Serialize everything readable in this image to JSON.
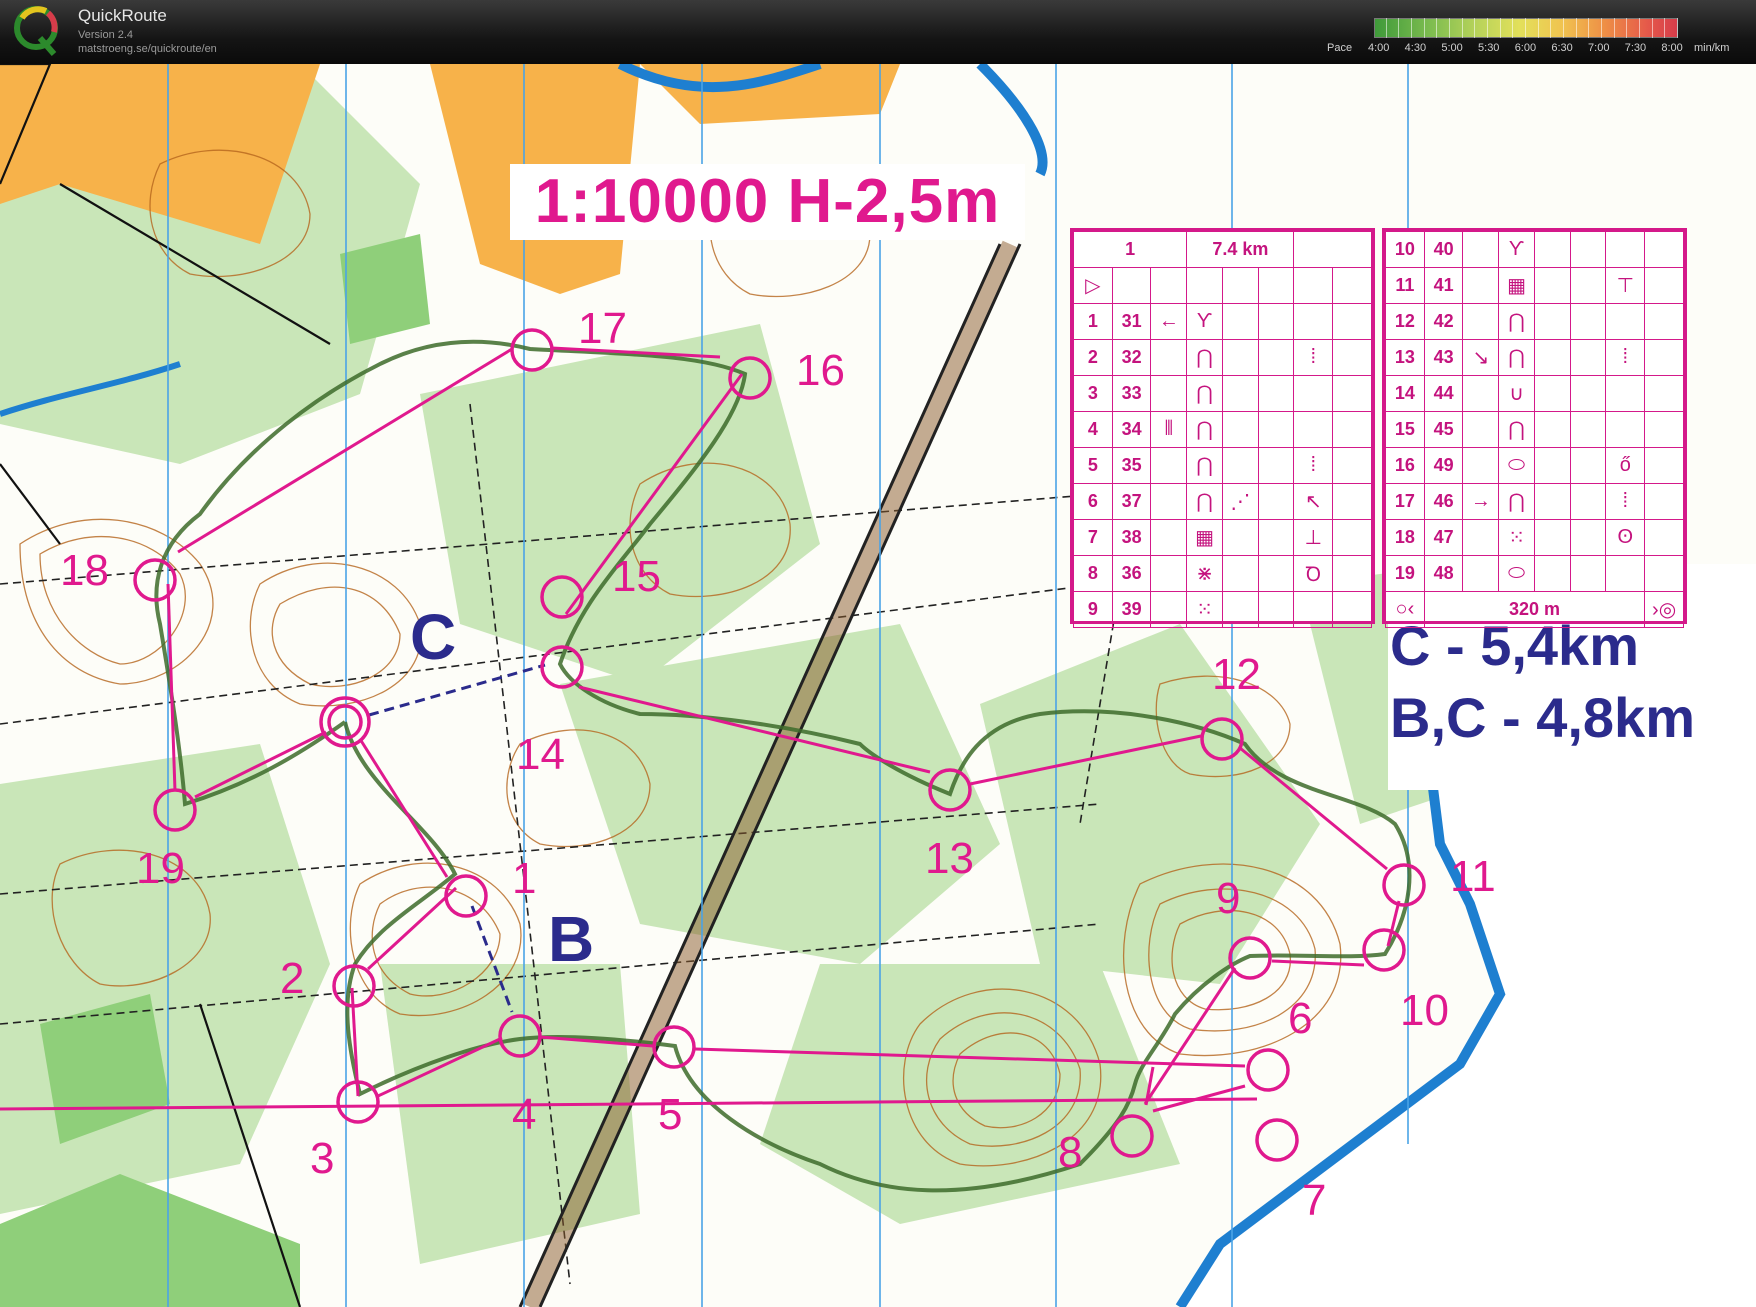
{
  "app": {
    "name": "QuickRoute",
    "version": "Version 2.4",
    "url": "matstroeng.se/quickroute/en",
    "logo_letter": "Q"
  },
  "pace_scale": {
    "label": "Pace",
    "values": [
      "4:00",
      "4:30",
      "5:00",
      "5:30",
      "6:00",
      "6:30",
      "7:00",
      "7:30",
      "8:00"
    ],
    "unit": "min/km"
  },
  "map": {
    "scale_text": "1:10000  H-2,5m",
    "distances": [
      "C - 5,4km",
      "B,C - 4,8km"
    ],
    "course_letters": [
      "C",
      "B"
    ],
    "colors": {
      "course": "#e0198e",
      "route": "#3d6b2a",
      "water": "#1e7fd0",
      "contour": "#b5651d",
      "forest": "#c7e3b7",
      "text_blue": "#2b2b8c"
    }
  },
  "controls": [
    {
      "n": "1"
    },
    {
      "n": "2"
    },
    {
      "n": "3"
    },
    {
      "n": "4"
    },
    {
      "n": "5"
    },
    {
      "n": "6"
    },
    {
      "n": "7"
    },
    {
      "n": "8"
    },
    {
      "n": "9"
    },
    {
      "n": "10"
    },
    {
      "n": "11"
    },
    {
      "n": "12"
    },
    {
      "n": "13"
    },
    {
      "n": "14"
    },
    {
      "n": "15"
    },
    {
      "n": "16"
    },
    {
      "n": "17"
    },
    {
      "n": "18"
    },
    {
      "n": "19"
    }
  ],
  "description_sheet": {
    "header": {
      "course": "1",
      "length": "7.4 km"
    },
    "left_rows": [
      {
        "num": "1",
        "code": "31",
        "dir": "←",
        "sym": "Ƴ",
        "extra": ""
      },
      {
        "num": "2",
        "code": "32",
        "dir": "",
        "sym": "⋂",
        "extra": "⁞"
      },
      {
        "num": "3",
        "code": "33",
        "dir": "",
        "sym": "⋂",
        "extra": ""
      },
      {
        "num": "4",
        "code": "34",
        "dir": "⫴",
        "sym": "⋂",
        "extra": ""
      },
      {
        "num": "5",
        "code": "35",
        "dir": "",
        "sym": "⋂",
        "extra": "⁞"
      },
      {
        "num": "6",
        "code": "37",
        "dir": "",
        "sym": "⋂",
        "extra": "↖"
      },
      {
        "num": "7",
        "code": "38",
        "dir": "",
        "sym": "▦",
        "extra": "⊥"
      },
      {
        "num": "8",
        "code": "36",
        "dir": "",
        "sym": "⋇",
        "extra": "Ꝺ"
      },
      {
        "num": "9",
        "code": "39",
        "dir": "",
        "sym": "⁙",
        "extra": ""
      }
    ],
    "right_rows": [
      {
        "num": "10",
        "code": "40",
        "dir": "",
        "sym": "Ƴ",
        "extra": ""
      },
      {
        "num": "11",
        "code": "41",
        "dir": "",
        "sym": "▦",
        "extra": "⊤"
      },
      {
        "num": "12",
        "code": "42",
        "dir": "",
        "sym": "⋂",
        "extra": ""
      },
      {
        "num": "13",
        "code": "43",
        "dir": "↘",
        "sym": "⋂",
        "extra": "⁞"
      },
      {
        "num": "14",
        "code": "44",
        "dir": "",
        "sym": "∪",
        "extra": ""
      },
      {
        "num": "15",
        "code": "45",
        "dir": "",
        "sym": "⋂",
        "extra": ""
      },
      {
        "num": "16",
        "code": "49",
        "dir": "",
        "sym": "⬭",
        "extra": "ő"
      },
      {
        "num": "17",
        "code": "46",
        "dir": "→",
        "sym": "⋂",
        "extra": "⁞"
      },
      {
        "num": "18",
        "code": "47",
        "dir": "",
        "sym": "⁙",
        "extra": "ʘ"
      },
      {
        "num": "19",
        "code": "48",
        "dir": "",
        "sym": "⬭",
        "extra": ""
      }
    ],
    "finish_distance": "320 m"
  }
}
